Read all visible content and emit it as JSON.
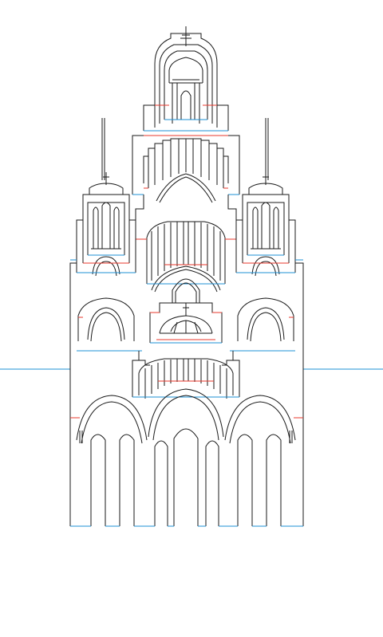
{
  "colors": {
    "background": "#ffffff",
    "cut_line": "#1a1a1a",
    "mountain_fold": "#e8392e",
    "valley_fold": "#1e90d6"
  }
}
